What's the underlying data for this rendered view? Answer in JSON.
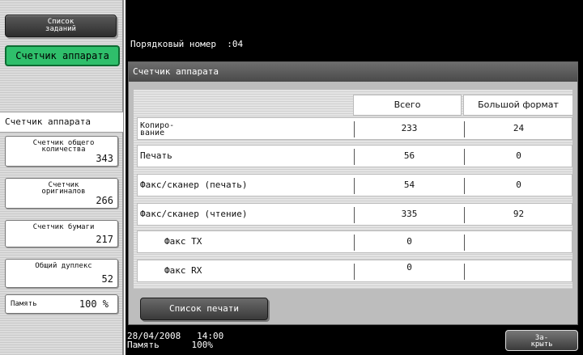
{
  "left": {
    "jobs_button": "Список\nзаданий",
    "counter_tab": "Счетчик аппарата",
    "section_header": "Счетчик аппарата",
    "cards": [
      {
        "label": "Счетчик общего\nколичества",
        "value": "343"
      },
      {
        "label": "Счетчик\nоригиналов",
        "value": "266"
      },
      {
        "label": "Счетчик бумаги",
        "value": "217"
      },
      {
        "label": "Общий дуплекс",
        "value": "52"
      }
    ],
    "memory": {
      "label": "Память",
      "value": "100 %"
    }
  },
  "right": {
    "serial_label": "Порядковый номер",
    "serial_value": ":04",
    "panel_title": "Счетчик аппарата",
    "columns": {
      "total": "Всего",
      "large": "Большой формат"
    },
    "rows": [
      {
        "name": "Копиро-\nвание",
        "total": "233",
        "large": "24"
      },
      {
        "name": "Печать",
        "total": "56",
        "large": "0"
      },
      {
        "name": "Факс/сканер (печать)",
        "total": "54",
        "large": "0"
      },
      {
        "name": "Факс/сканер (чтение)",
        "total": "335",
        "large": "92"
      },
      {
        "name": "Факс TX",
        "total": "0",
        "large": ""
      },
      {
        "name": "Факс RX",
        "total": "0",
        "large": ""
      }
    ],
    "print_list_button": "Список печати",
    "status_datetime": "28/04/2008   14:00",
    "status_memory": "Память      100%",
    "close_button": "За-\nкрыть"
  }
}
